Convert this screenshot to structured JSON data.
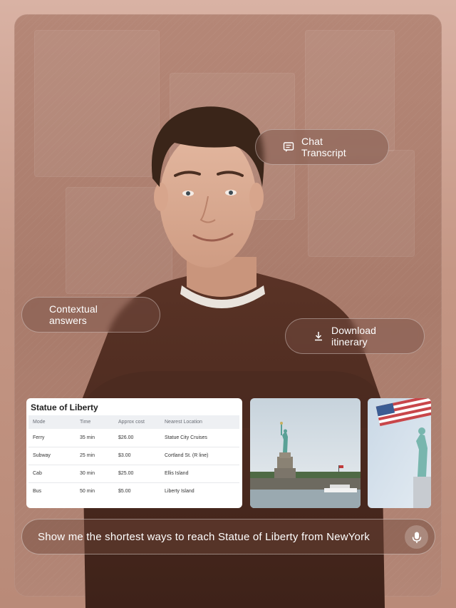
{
  "chips": {
    "chat_transcript": "Chat Transcript",
    "contextual_answers": "Contextual answers",
    "download_itinerary": "Download itinerary"
  },
  "info_card": {
    "title": "Statue of Liberty",
    "columns": [
      "Mode",
      "Time",
      "Approx cost",
      "Nearest Location"
    ],
    "rows": [
      [
        "Ferry",
        "35 min",
        "$26.00",
        "Statue City Cruises"
      ],
      [
        "Subway",
        "25 min",
        "$3.00",
        "Cortland St. (R line)"
      ],
      [
        "Cab",
        "30 min",
        "$25.00",
        "Ellis Island"
      ],
      [
        "Bus",
        "50 min",
        "$5.00",
        "Liberty Island"
      ]
    ]
  },
  "prompt": {
    "text": "Show me the shortest ways to reach Statue of Liberty from NewYork"
  },
  "icons": {
    "chat": "chat-icon",
    "download": "download-icon",
    "mic": "microphone-icon"
  },
  "colors": {
    "background": "#c49684",
    "chip_bg": "#78504473",
    "text": "#ffffff"
  }
}
